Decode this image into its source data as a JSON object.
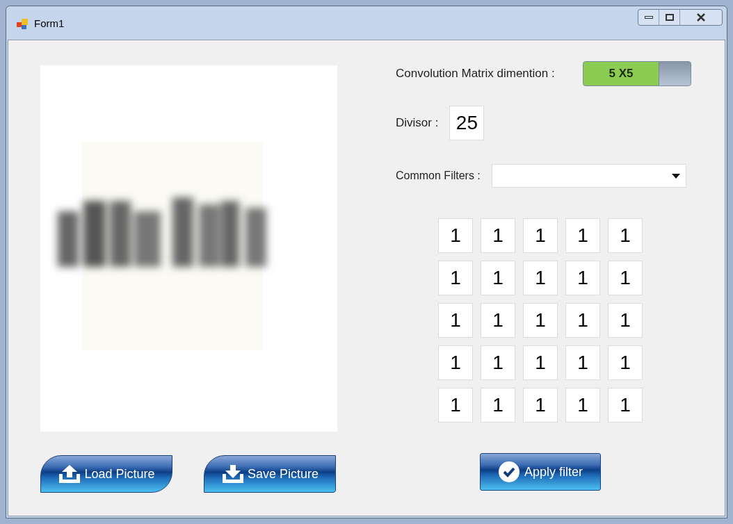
{
  "window": {
    "title": "Form1"
  },
  "matrix_dimension": {
    "label": "Convolution Matrix dimention :",
    "value": "5 X5",
    "on": true
  },
  "divisor": {
    "label": "Divisor :",
    "value": "25"
  },
  "common_filters": {
    "label": "Common Filters :"
  },
  "matrix": [
    [
      "1",
      "1",
      "1",
      "1",
      "1"
    ],
    [
      "1",
      "1",
      "1",
      "1",
      "1"
    ],
    [
      "1",
      "1",
      "1",
      "1",
      "1"
    ],
    [
      "1",
      "1",
      "1",
      "1",
      "1"
    ],
    [
      "1",
      "1",
      "1",
      "1",
      "1"
    ]
  ],
  "buttons": [
    {
      "label": "Load Picture",
      "kind": "load"
    },
    {
      "label": "Save Picture",
      "kind": "save"
    }
  ],
  "apply_button": {
    "label": "Apply filter"
  }
}
